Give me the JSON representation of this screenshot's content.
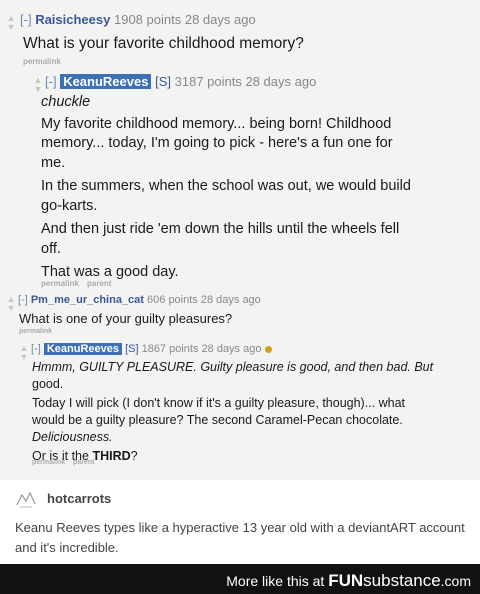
{
  "comments": [
    {
      "toggle": "[-]",
      "author": "Raisicheesy",
      "points": "1908 points",
      "age": "28 days ago",
      "lines": [
        "What is your favorite childhood memory?"
      ],
      "links": [
        "permalink"
      ]
    },
    {
      "toggle": "[-]",
      "author": "KeanuReeves",
      "submitter": "[S]",
      "points": "3187 points",
      "age": "28 days ago",
      "lines": [
        "chuckle",
        "My favorite childhood memory... being born! Childhood",
        "memory... today, I'm going to pick - here's a fun one for",
        "me.",
        "In the summers, when the school was out, we would build",
        "go-karts.",
        "And then just ride 'em down the hills until the wheels fell",
        "off.",
        "That was a good day."
      ],
      "links": [
        "permalink",
        "parent"
      ]
    },
    {
      "toggle": "[-]",
      "author": "Pm_me_ur_china_cat",
      "points": "606 points",
      "age": "28 days ago",
      "lines": [
        "What is one of your guilty pleasures?"
      ],
      "links": [
        "permalink"
      ]
    },
    {
      "toggle": "[-]",
      "author": "KeanuReeves",
      "submitter": "[S]",
      "points": "1867 points",
      "age": "28 days ago",
      "lines": [
        "Hmmm, GUILTY PLEASURE. Guilty pleasure is good, and then bad. But",
        "good.",
        "Today I will pick (I don't know if it's a guilty pleasure, though)... what",
        "would be a guilty pleasure? The second Caramel-Pecan chocolate.",
        "Deliciousness.",
        "Or is it the ",
        "THIRD",
        "?"
      ],
      "links": [
        "permalink",
        "parent"
      ]
    }
  ],
  "tumblr": {
    "username": "hotcarrots",
    "post_lines": [
      "Keanu Reeves types like a hyperactive 13 year old with a deviantART account",
      "and it's incredible."
    ]
  },
  "footer": {
    "prefix": "More like this at",
    "brand_bold": "FUN",
    "brand_rest": "substance",
    "domain": ".com"
  },
  "colors": {
    "thread_bg": "#f3f3f1",
    "author_box": "#3f6fb5",
    "author_link": "#3b5998",
    "footer_bg": "#111111",
    "gold_dot": "#d4a017"
  }
}
